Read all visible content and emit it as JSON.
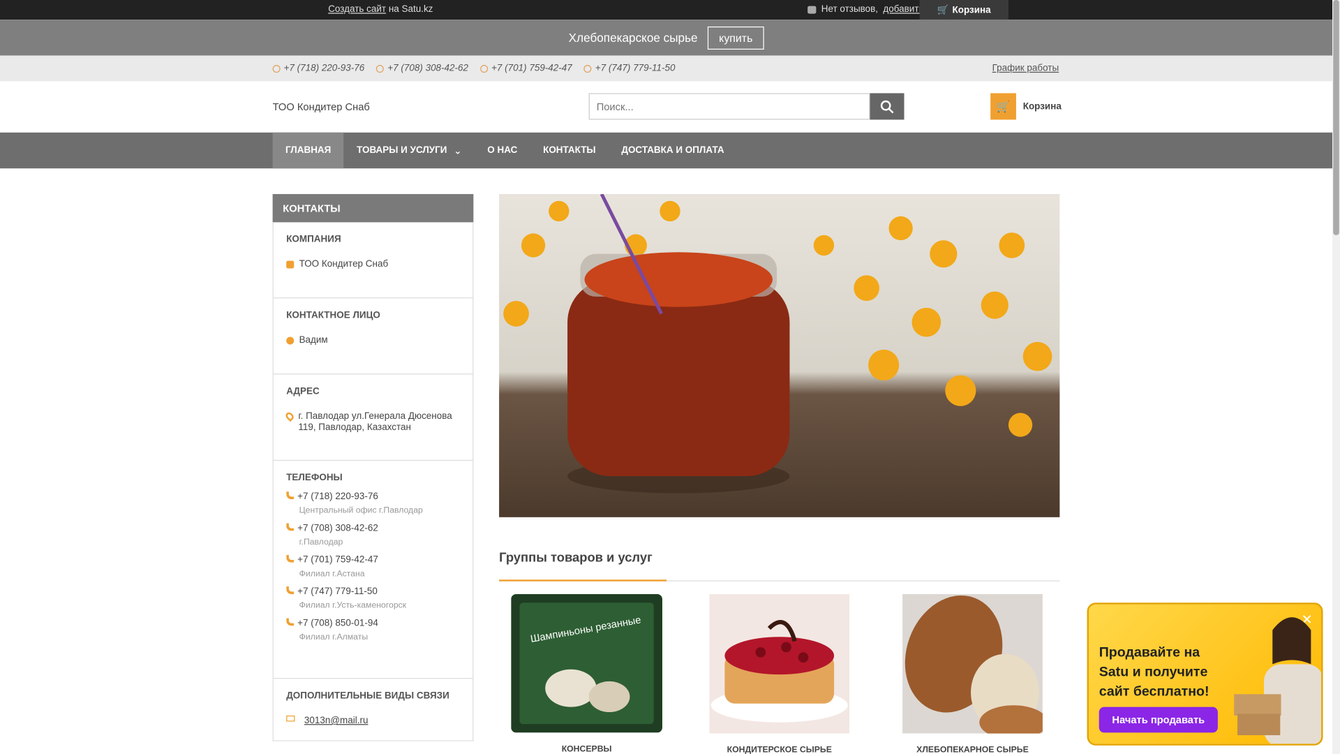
{
  "topbar": {
    "create_link": "Создать сайт",
    "create_suffix": "на Satu.kz",
    "reviews_text": "Нет отзывов,",
    "reviews_link": "добавить",
    "cart": "Корзина"
  },
  "promo": {
    "text": "Хлебопекарское сырье",
    "button": "купить"
  },
  "phones": [
    "+7 (718) 220-93-76",
    "+7 (708) 308-42-62",
    "+7 (701) 759-42-47",
    "+7 (747) 779-11-50"
  ],
  "schedule_link": "График работы",
  "header": {
    "company": "ТОО Кондитер Снаб",
    "search_placeholder": "Поиск...",
    "cart": "Корзина"
  },
  "nav": [
    "ГЛАВНАЯ",
    "ТОВАРЫ И УСЛУГИ",
    "О НАС",
    "КОНТАКТЫ",
    "ДОСТАВКА И ОПЛАТА"
  ],
  "sidebar": {
    "title": "КОНТАКТЫ",
    "company_h": "КОМПАНИЯ",
    "company": "ТОО Кондитер Снаб",
    "person_h": "КОНТАКТНОЕ ЛИЦО",
    "person": "Вадим",
    "address_h": "АДРЕС",
    "address": "г. Павлодар ул.Генерала Дюсенова 119, Павлодар, Казахстан",
    "phones_h": "ТЕЛЕФОНЫ",
    "phones": [
      {
        "num": "+7 (718) 220-93-76",
        "sub": "Центральный офис г.Павлодар"
      },
      {
        "num": "+7 (708) 308-42-62",
        "sub": "г.Павлодар"
      },
      {
        "num": "+7 (701) 759-42-47",
        "sub": "Филиал г.Астана"
      },
      {
        "num": "+7 (747) 779-11-50",
        "sub": "Филиал г.Усть-каменогорск"
      },
      {
        "num": "+7 (708) 850-01-94",
        "sub": "Филиал г.Алматы"
      }
    ],
    "extra_h": "ДОПОЛНИТЕЛЬНЫЕ ВИДЫ СВЯЗИ",
    "email": "3013n@mail.ru"
  },
  "groups": {
    "title": "Группы товаров и услуг",
    "items": [
      "КОНСЕРВЫ",
      "КОНДИТЕРСКОЕ СЫРЬЕ",
      "ХЛЕБОПЕКАРНОЕ СЫРЬЕ"
    ],
    "can_label": "Шампиньоны резанные"
  },
  "popup": {
    "text": "Продавайте на Satu и получите сайт бесплатно!",
    "button": "Начать продавать",
    "close": "✕"
  }
}
